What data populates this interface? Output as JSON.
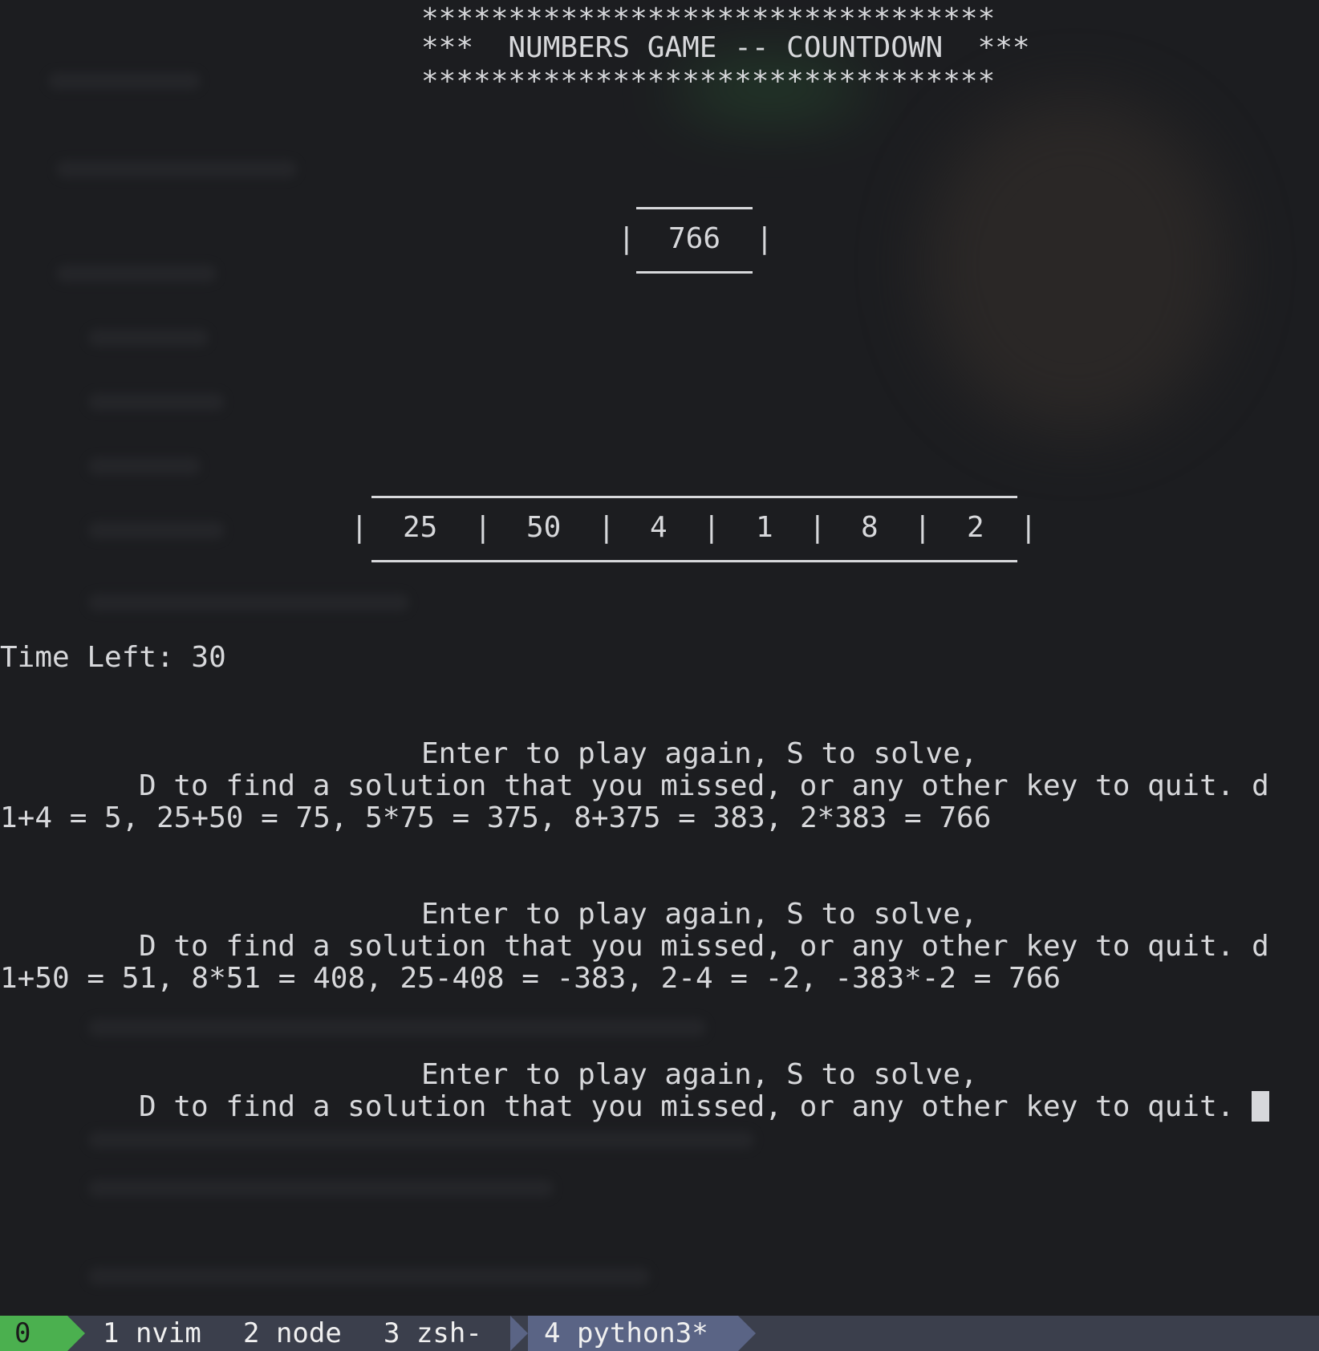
{
  "terminal": {
    "banner": {
      "top_border": "*********************************",
      "title_line": "***  NUMBERS GAME -- COUNTDOWN  ***",
      "bottom_border": "*********************************"
    },
    "target": {
      "left_bar": "|",
      "value": "766",
      "right_bar": "|"
    },
    "numbers_row": {
      "separator": "|",
      "numbers": [
        "25",
        "50",
        "4",
        "1",
        "8",
        "2"
      ]
    },
    "time_left": "Time Left: 30",
    "rounds": [
      {
        "prompt_line1": "Enter to play again, S to solve,",
        "prompt_line2": "D to find a solution that you missed, or any other key to quit. d",
        "solution": "1+4 = 5, 25+50 = 75, 5*75 = 375, 8+375 = 383, 2*383 = 766"
      },
      {
        "prompt_line1": "Enter to play again, S to solve,",
        "prompt_line2": "D to find a solution that you missed, or any other key to quit. d",
        "solution": "1+50 = 51, 8*51 = 408, 25-408 = -383, 2-4 = -2, -383*-2 = 766"
      },
      {
        "prompt_line1": "Enter to play again, S to solve,",
        "prompt_line2": "D to find a solution that you missed, or any other key to quit. "
      }
    ]
  },
  "statusbar": {
    "session": "0",
    "windows": [
      {
        "label": "1 nvim"
      },
      {
        "label": "2 node"
      },
      {
        "label": "3 zsh-"
      },
      {
        "label": "4 python3*",
        "active": true
      }
    ],
    "colors": {
      "session_bg": "#4bb04f",
      "bar_bg": "#3b3f4c",
      "active_bg": "#5a6485"
    }
  }
}
